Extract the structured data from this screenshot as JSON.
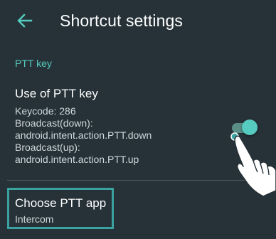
{
  "appbar": {
    "title": "Shortcut settings",
    "back_icon": "arrow-left-icon"
  },
  "section": {
    "header": "PTT key"
  },
  "ptt_key_pref": {
    "title": "Use of PTT key",
    "summary_lines": [
      "Keycode: 286",
      "Broadcast(down):",
      "android.intent.action.PTT.down",
      "Broadcast(up):",
      "android.intent.action.PTT.up"
    ],
    "switch_on": true
  },
  "ptt_app_pref": {
    "title": "Choose PTT app",
    "summary": "Intercom"
  },
  "colors": {
    "background": "#263238",
    "accent": "#56cbbf",
    "highlight_border": "#3aa3a0",
    "summary_text": "#cfd8dc"
  },
  "icons": {
    "touch_hand": "pointing-hand-icon"
  }
}
